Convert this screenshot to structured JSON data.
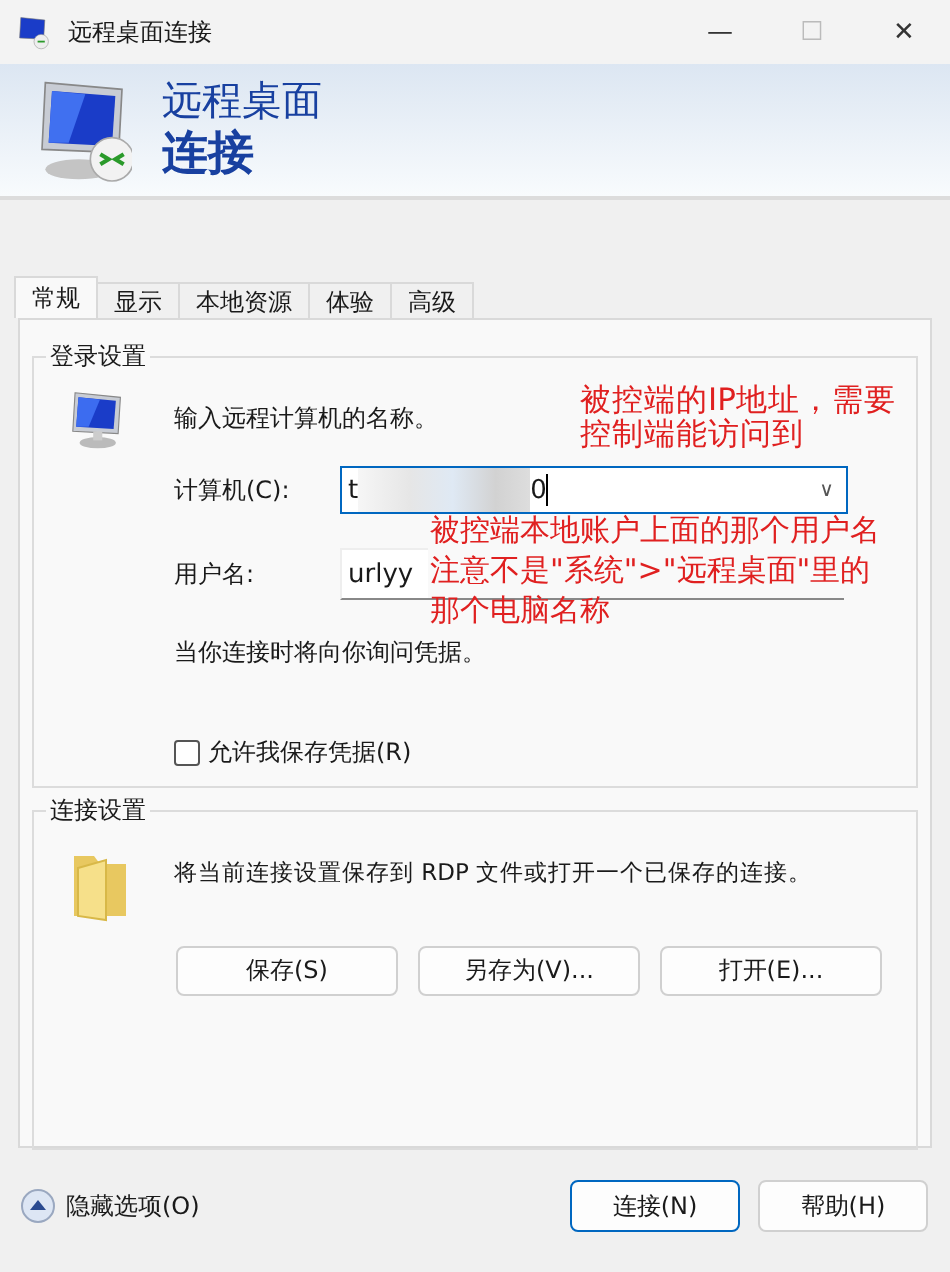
{
  "window": {
    "title": "远程桌面连接",
    "controls": [
      "—",
      "☐",
      "✕"
    ]
  },
  "banner": {
    "line1": "远程桌面",
    "line2": "连接"
  },
  "tabs": [
    {
      "label": "常规",
      "selected": true
    },
    {
      "label": "显示",
      "selected": false
    },
    {
      "label": "本地资源",
      "selected": false
    },
    {
      "label": "体验",
      "selected": false
    },
    {
      "label": "高级",
      "selected": false
    }
  ],
  "login": {
    "legend": "登录设置",
    "prompt": "输入远程计算机的名称。",
    "computer": {
      "label": "计算机(C):",
      "value_start": "t",
      "value_end": "0",
      "dropdown": "∨",
      "focused": true
    },
    "username": {
      "label": "用户名:",
      "value": "urlyy"
    },
    "note": "当你连接时将向你询问凭据。",
    "save_credentials": {
      "label": "允许我保存凭据(R)",
      "checked": false
    }
  },
  "connection": {
    "legend": "连接设置",
    "text": "将当前连接设置保存到 RDP 文件或打开一个已保存的连接。",
    "buttons": [
      "保存(S)",
      "另存为(V)...",
      "打开(E)..."
    ]
  },
  "annotations": [
    {
      "lines": [
        "被控端的IP地址，需要",
        "控制端能访问到"
      ]
    },
    {
      "lines": [
        "被控端本地账户上面的那个用户名",
        "注意不是\"系统\">\"远程桌面\"里的",
        "那个电脑名称"
      ]
    }
  ],
  "footer": {
    "toggle": "隐藏选项(O)",
    "buttons": [
      {
        "label": "连接(N)",
        "default": true
      },
      {
        "label": "帮助(H)",
        "default": false
      }
    ]
  }
}
